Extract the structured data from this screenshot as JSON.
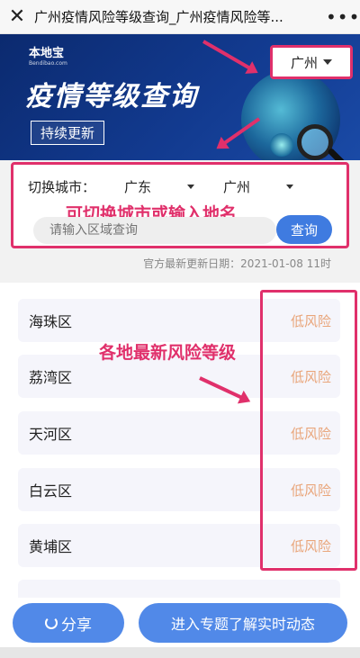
{
  "titlebar": {
    "title": "广州疫情风险等级查询_广州疫情风险等...",
    "close_glyph": "✕",
    "more_glyph": "•••"
  },
  "banner": {
    "logo_cn": "本地宝",
    "logo_en": "Bendibao.com",
    "heading": "疫情等级查询",
    "tag": "持续更新",
    "city": "广州"
  },
  "query": {
    "label": "切换城市：",
    "province": "广东",
    "city": "广州",
    "hint": "可切换城市或输入地名",
    "placeholder": "请输入区域查询",
    "button": "查询"
  },
  "update_text": "官方最新更新日期：2021-01-08 11时",
  "list_hint": "各地最新风险等级",
  "districts": [
    {
      "name": "海珠区",
      "risk": "低风险"
    },
    {
      "name": "荔湾区",
      "risk": "低风险"
    },
    {
      "name": "天河区",
      "risk": "低风险"
    },
    {
      "name": "白云区",
      "risk": "低风险"
    },
    {
      "name": "黄埔区",
      "risk": "低风险"
    }
  ],
  "bottom": {
    "share": "分享",
    "topic": "进入专题了解实时动态"
  },
  "colors": {
    "accent": "#e0306b",
    "primary": "#5189e8",
    "risk_low": "#e9a57a"
  }
}
